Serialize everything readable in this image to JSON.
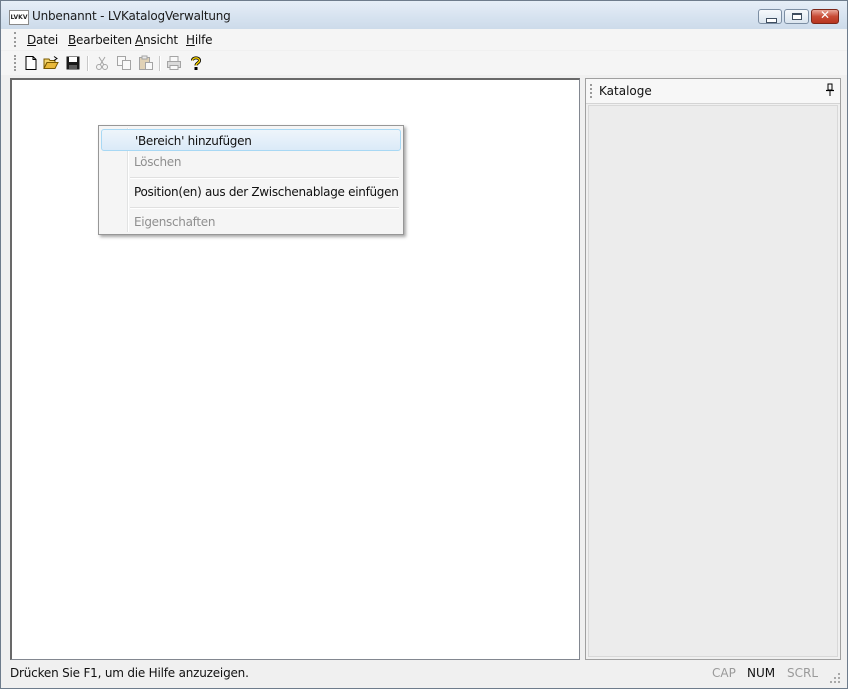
{
  "window": {
    "title": "Unbenannt - LVKatalogVerwaltung",
    "app_icon_text": "LVKV",
    "controls": {
      "minimize": "minimize",
      "maximize": "maximize",
      "close": "✕"
    }
  },
  "menubar": {
    "items": [
      "Datei",
      "Bearbeiten",
      "Ansicht",
      "Hilfe"
    ]
  },
  "toolbar": {
    "buttons": [
      {
        "icon": "new-document-icon",
        "enabled": true
      },
      {
        "icon": "open-folder-icon",
        "enabled": true
      },
      {
        "icon": "save-icon",
        "enabled": true
      },
      {
        "icon": "cut-icon",
        "enabled": false
      },
      {
        "icon": "copy-icon",
        "enabled": false
      },
      {
        "icon": "paste-icon",
        "enabled": false
      },
      {
        "icon": "print-icon",
        "enabled": false
      },
      {
        "icon": "help-icon",
        "enabled": true
      }
    ]
  },
  "context_menu": {
    "items": [
      {
        "label": "'Bereich' hinzufügen",
        "enabled": true,
        "highlighted": true
      },
      {
        "label": "Löschen",
        "enabled": false
      },
      {
        "label": "Position(en) aus der Zwischenablage einfügen",
        "enabled": true
      },
      {
        "label": "Eigenschaften",
        "enabled": false
      }
    ]
  },
  "panel": {
    "title": "Kataloge"
  },
  "statusbar": {
    "text": "Drücken Sie F1, um die Hilfe anzuzeigen.",
    "indicators": [
      {
        "label": "CAP",
        "active": false
      },
      {
        "label": "NUM",
        "active": true
      },
      {
        "label": "SCRL",
        "active": false
      }
    ]
  },
  "colors": {
    "title_gradient": "#d7e3f0",
    "menu_highlight_border": "#a8d8f4",
    "disabled_text": "#8f8f8f",
    "close_button": "#c74a35"
  }
}
